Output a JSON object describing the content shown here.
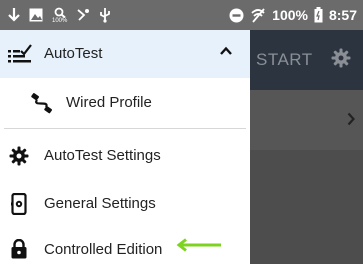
{
  "status_bar": {
    "battery_percent": "100%",
    "time": "8:57",
    "signal_badge": "100%"
  },
  "drawer": {
    "items": [
      {
        "label": "AutoTest",
        "icon": "checklist-icon",
        "expanded": true
      },
      {
        "label": "Wired Profile",
        "icon": "ethernet-cable-icon"
      },
      {
        "label": "AutoTest Settings",
        "icon": "gear-icon"
      },
      {
        "label": "General Settings",
        "icon": "device-settings-icon"
      },
      {
        "label": "Controlled Edition",
        "icon": "lock-icon"
      }
    ]
  },
  "background_app": {
    "start_label": "START",
    "gear_icon": "gear-icon",
    "row_chevron": "chevron-right-icon"
  },
  "colors": {
    "status_bar_bg": "#6b6b6b",
    "drawer_selected_bg": "#e6f1fb",
    "app_header_bg": "#2c3440",
    "annotation_arrow": "#7ed321"
  }
}
